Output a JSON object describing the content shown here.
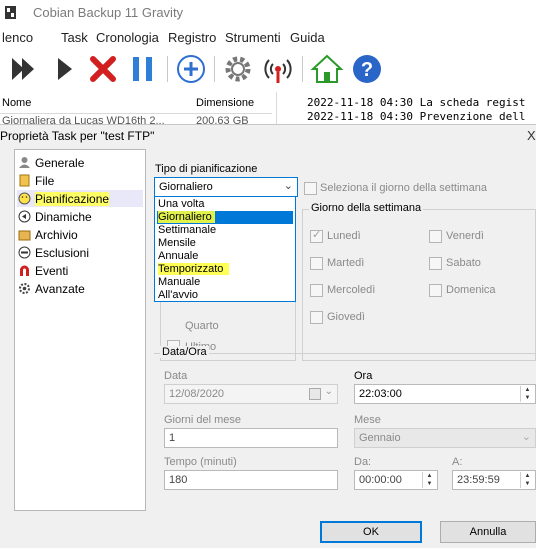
{
  "app": {
    "title": "Cobian Backup 11 Gravity"
  },
  "menu": [
    "lenco",
    "Task",
    "Cronologia",
    "Registro",
    "Strumenti",
    "Guida"
  ],
  "list": {
    "col_name": "Nome",
    "col_size": "Dimensione",
    "row_text": "Giornaliera da Lucas WD16th 2...",
    "row_size": "200,63 GB"
  },
  "log": [
    "2022-11-18 04:30 La scheda regist",
    "2022-11-18 04:30 Prevenzione dell"
  ],
  "dialog": {
    "title": "Proprietà Task per \"test FTP\"",
    "close": "X",
    "sidebar": [
      {
        "label": "Generale",
        "icon": "user-icon"
      },
      {
        "label": "File",
        "icon": "file-icon"
      },
      {
        "label": "Pianificazione",
        "icon": "smiley-icon"
      },
      {
        "label": "Dinamiche",
        "icon": "dynamics-icon"
      },
      {
        "label": "Archivio",
        "icon": "archive-icon"
      },
      {
        "label": "Esclusioni",
        "icon": "exclusion-icon"
      },
      {
        "label": "Eventi",
        "icon": "magnet-icon"
      },
      {
        "label": "Avanzate",
        "icon": "gear-icon"
      }
    ],
    "schedule": {
      "type_label": "Tipo di pianificazione",
      "type_value": "Giornaliero",
      "select_day_label": "Seleziona il giorno della settimana",
      "options": [
        "Una volta",
        "Giornaliero",
        "Settimanale",
        "Mensile",
        "Annuale",
        "Temporizzato",
        "Manuale",
        "All'avvio"
      ],
      "selected_option": "Giornaliero",
      "partial_label": "Quarto",
      "last_label": "Ultimo",
      "weekday_group": "Giorno della settimana",
      "weekdays": [
        {
          "label": "Lunedì",
          "checked": true
        },
        {
          "label": "Martedì",
          "checked": false
        },
        {
          "label": "Mercoledì",
          "checked": false
        },
        {
          "label": "Giovedì",
          "checked": false
        },
        {
          "label": "Venerdì",
          "checked": false
        },
        {
          "label": "Sabato",
          "checked": false
        },
        {
          "label": "Domenica",
          "checked": false
        }
      ]
    },
    "datetime": {
      "group": "Data/Ora",
      "date_label": "Data",
      "date_value": "12/08/2020",
      "time_label": "Ora",
      "time_value": "22:03:00",
      "day_of_month_label": "Giorni del mese",
      "day_of_month_value": "1",
      "month_label": "Mese",
      "month_value": "Gennaio",
      "timer_label": "Tempo (minuti)",
      "timer_value": "180",
      "from_label": "Da:",
      "from_value": "00:00:00",
      "to_label": "A:",
      "to_value": "23:59:59"
    },
    "ok": "OK",
    "cancel": "Annulla"
  },
  "colors": {
    "accent": "#0078d7",
    "highlight": "#ffff55"
  }
}
